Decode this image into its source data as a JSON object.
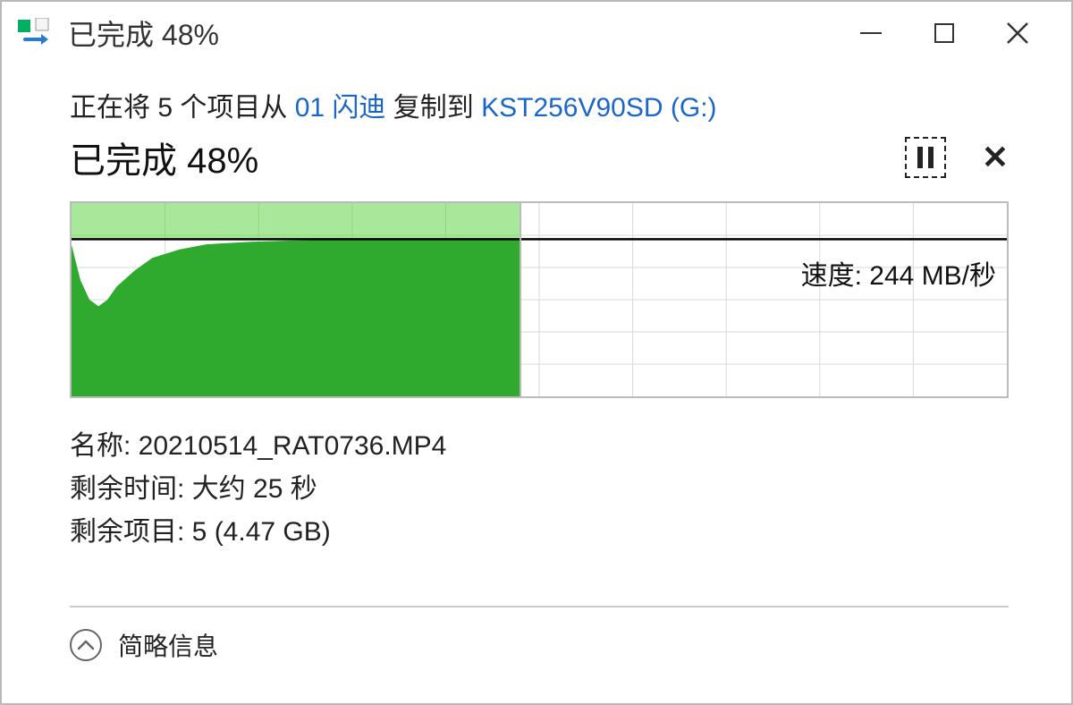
{
  "window": {
    "title": "已完成 48%"
  },
  "copy": {
    "desc_prefix": "正在将 5 个项目从 ",
    "source": "01 闪迪",
    "desc_mid": " 复制到 ",
    "destination": "KST256V90SD (G:)",
    "progress_label": "已完成 48%",
    "percent": 48
  },
  "speed": {
    "label": "速度: 244 MB/秒"
  },
  "details": {
    "name_label": "名称: ",
    "name_value": "20210514_RAT0736.MP4",
    "time_label": "剩余时间: ",
    "time_value": "大约 25 秒",
    "items_label": "剩余项目: ",
    "items_value": "5 (4.47 GB)"
  },
  "footer": {
    "brief_label": "简略信息"
  },
  "chart_data": {
    "type": "area",
    "title": "",
    "xlabel": "",
    "ylabel": "",
    "ylim": [
      0,
      300
    ],
    "speed_line": 244,
    "progress_percent": 48,
    "x": [
      0,
      2,
      4,
      6,
      8,
      10,
      14,
      18,
      24,
      30,
      40,
      50,
      60,
      70,
      80,
      90,
      100
    ],
    "values": [
      235,
      180,
      150,
      140,
      150,
      170,
      195,
      215,
      228,
      236,
      240,
      242,
      243,
      244,
      244,
      244,
      244
    ],
    "grid": {
      "cols": 10,
      "rows": 6
    }
  }
}
